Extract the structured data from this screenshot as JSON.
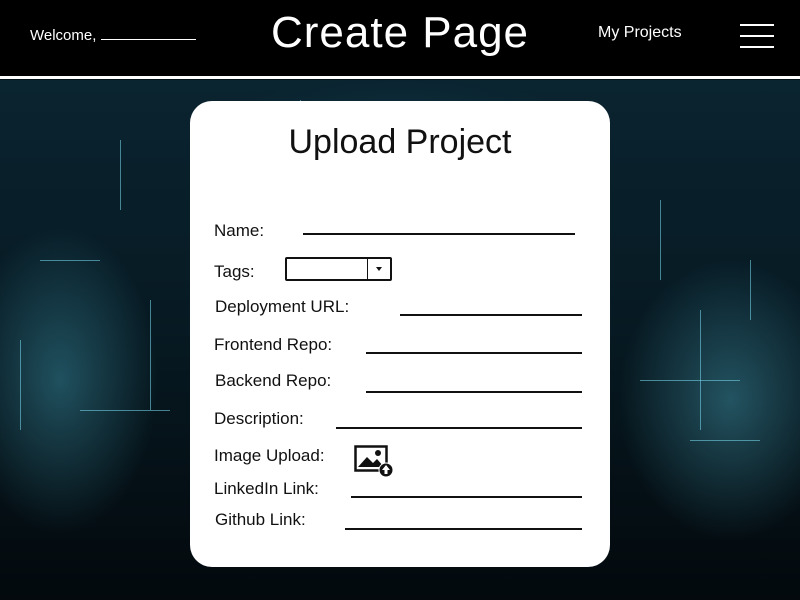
{
  "header": {
    "welcome_text": "Welcome,",
    "title": "Create Page",
    "nav_link": "My Projects",
    "menu_icon": "hamburger-menu-icon"
  },
  "form": {
    "title": "Upload Project",
    "fields": {
      "name": "Name:",
      "tags": "Tags:",
      "deployment_url": "Deployment URL:",
      "frontend_repo": "Frontend Repo:",
      "backend_repo": "Backend Repo:",
      "description": "Description:",
      "image_upload": "Image Upload:",
      "linkedin_link": "LinkedIn Link:",
      "github_link": "Github Link:"
    },
    "tags_selected": "",
    "upload_icon": "image-upload-icon"
  },
  "colors": {
    "header_bg": "#000000",
    "card_bg": "#ffffff",
    "text": "#111111"
  }
}
